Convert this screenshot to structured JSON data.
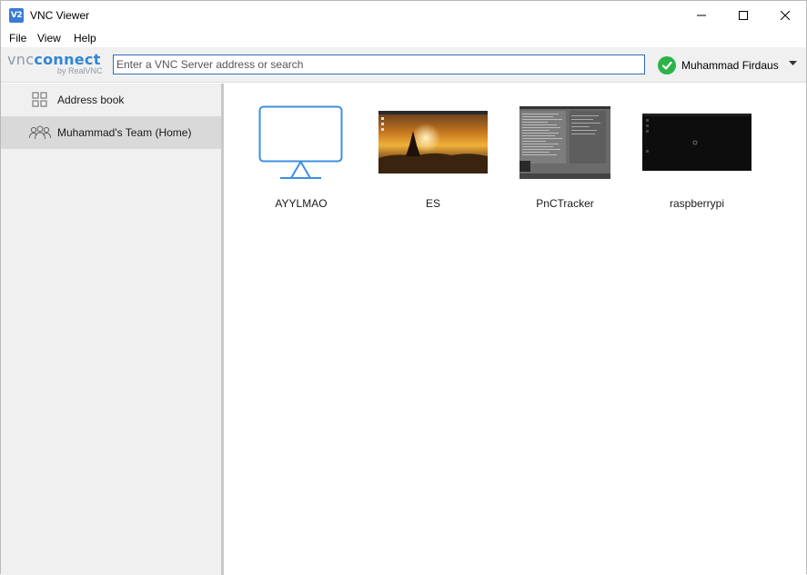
{
  "window": {
    "title": "VNC Viewer",
    "app_icon_text": "V2"
  },
  "menu": {
    "items": [
      "File",
      "View",
      "Help"
    ]
  },
  "toolbar": {
    "logo_vnc": "vnc",
    "logo_connect": "connect",
    "logo_sub": "by RealVNC",
    "search_placeholder": "Enter a VNC Server address or search",
    "search_value": "",
    "user_name": "Muhammad Firdaus",
    "status_color": "#2bb34a"
  },
  "sidebar": {
    "items": [
      {
        "label": "Address book",
        "icon": "grid-icon",
        "selected": false
      },
      {
        "label": "Muhammad's Team (Home)",
        "icon": "team-icon",
        "selected": true
      }
    ]
  },
  "computers": [
    {
      "name": "AYYLMAO",
      "thumbnail": "monitor-icon"
    },
    {
      "name": "ES",
      "thumbnail": "sunset-pagoda-screenshot"
    },
    {
      "name": "PnCTracker",
      "thumbnail": "terminal-screenshot"
    },
    {
      "name": "raspberrypi",
      "thumbnail": "dark-desktop-screenshot"
    }
  ],
  "colors": {
    "accent": "#2f86d6",
    "selection": "#d9d9d9",
    "sidebar_bg": "#f0f0f0"
  }
}
